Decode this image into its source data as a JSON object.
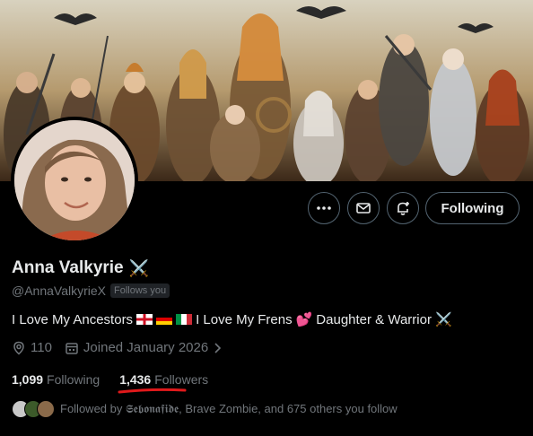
{
  "profile": {
    "display_name": "Anna Valkyrie",
    "name_emoji": "⚔️",
    "handle": "@AnnaValkyrieX",
    "follows_you_badge": "Follows you",
    "bio": {
      "part1": "I Love My Ancestors",
      "part2": "I Love My Frens",
      "part3": "Daughter & Warrior",
      "heart_emoji": "💕",
      "swords_emoji": "⚔️"
    },
    "location": "110",
    "joined": "Joined January 2026",
    "following_count": "1,099",
    "following_label": "Following",
    "followers_count": "1,436",
    "followers_label": "Followers",
    "followed_by": "Followed by 𝕾𝖊𝖇𝖔𝖓𝖆𝖋𝖎𝖉𝖊, Brave Zombie, and 675 others you follow"
  },
  "actions": {
    "more_icon": "more-horizontal-icon",
    "message_icon": "envelope-icon",
    "notify_icon": "bell-plus-icon",
    "follow_label": "Following"
  },
  "colors": {
    "background": "#000000",
    "text_primary": "#e7e9ea",
    "text_secondary": "#71767b",
    "border": "#536471",
    "annotation_red": "#e0191b"
  }
}
